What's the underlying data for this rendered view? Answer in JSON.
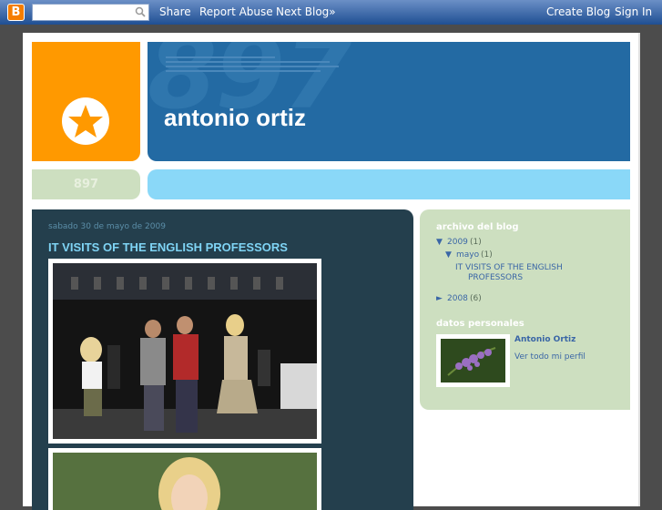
{
  "navbar": {
    "logo_letter": "B",
    "share": "Share",
    "report_abuse": "Report Abuse",
    "next_blog": "Next Blog»",
    "create_blog": "Create Blog",
    "sign_in": "Sign In"
  },
  "header": {
    "title": "antonio ortiz",
    "watermark": "897",
    "bar_label": "897"
  },
  "post": {
    "date": "sabado 30 de mayo de 2009",
    "title": "IT VISITS OF THE ENGLISH PROFESSORS"
  },
  "sidebar": {
    "archive_heading": "archivo del blog",
    "year_2009": "2009",
    "year_2009_count": "(1)",
    "month_mayo": "mayo",
    "month_mayo_count": "(1)",
    "post_link_line1": "IT VISITS OF THE ENGLISH",
    "post_link_line2": "PROFESSORS",
    "year_2008": "2008",
    "year_2008_count": "(6)",
    "profile_heading": "datos personales",
    "profile_name": "Antonio Ortiz",
    "profile_link": "Ver todo mi perfil"
  },
  "colors": {
    "navbar": "#1f4f93",
    "orange": "#ff9900",
    "header_blue": "#236aa3",
    "post_bg": "#243f4d",
    "post_title": "#7fd4f5",
    "sidebar_bg": "#cddfc0",
    "bar_cyan": "#8ad8f8"
  }
}
